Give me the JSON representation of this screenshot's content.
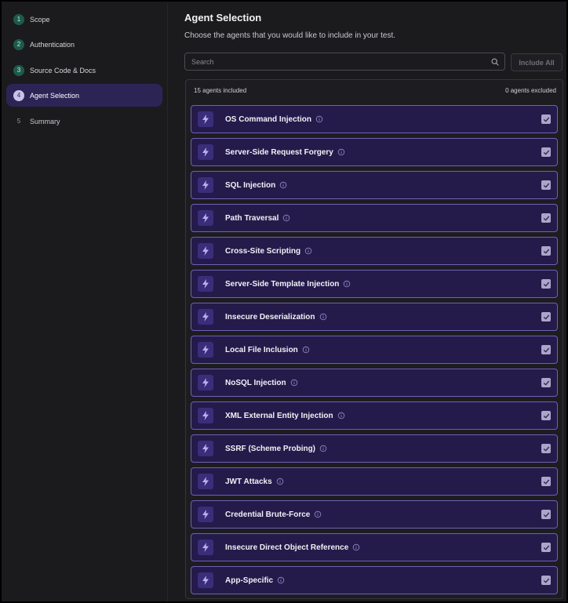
{
  "sidebar": {
    "steps": [
      {
        "num": "1",
        "label": "Scope",
        "state": "done"
      },
      {
        "num": "2",
        "label": "Authentication",
        "state": "done"
      },
      {
        "num": "3",
        "label": "Source Code & Docs",
        "state": "done"
      },
      {
        "num": "4",
        "label": "Agent Selection",
        "state": "current"
      },
      {
        "num": "5",
        "label": "Summary",
        "state": "todo"
      }
    ]
  },
  "main": {
    "title": "Agent Selection",
    "subtitle": "Choose the agents that you would like to include in your test.",
    "search": {
      "placeholder": "Search",
      "value": ""
    },
    "include_all_label": "Include All",
    "included_count": "15 agents included",
    "excluded_count": "0 agents excluded",
    "agents": [
      {
        "name": "OS Command Injection",
        "checked": true
      },
      {
        "name": "Server-Side Request Forgery",
        "checked": true
      },
      {
        "name": "SQL Injection",
        "checked": true
      },
      {
        "name": "Path Traversal",
        "checked": true
      },
      {
        "name": "Cross-Site Scripting",
        "checked": true
      },
      {
        "name": "Server-Side Template Injection",
        "checked": true
      },
      {
        "name": "Insecure Deserialization",
        "checked": true
      },
      {
        "name": "Local File Inclusion",
        "checked": true
      },
      {
        "name": "NoSQL Injection",
        "checked": true
      },
      {
        "name": "XML External Entity Injection",
        "checked": true
      },
      {
        "name": "SSRF (Scheme Probing)",
        "checked": true
      },
      {
        "name": "JWT Attacks",
        "checked": true
      },
      {
        "name": "Credential Brute-Force",
        "checked": true
      },
      {
        "name": "Insecure Direct Object Reference",
        "checked": true
      },
      {
        "name": "App-Specific",
        "checked": true
      }
    ]
  },
  "colors": {
    "accent": "#6f5fb5",
    "agent_bg": "#241b4b",
    "step_done": "#1c5b4b",
    "active_step_bg": "#2d2456"
  },
  "icons": {
    "agent": "lightning-bolt-icon",
    "info": "info-circle-icon",
    "check": "checkmark-icon",
    "search": "search-icon"
  }
}
